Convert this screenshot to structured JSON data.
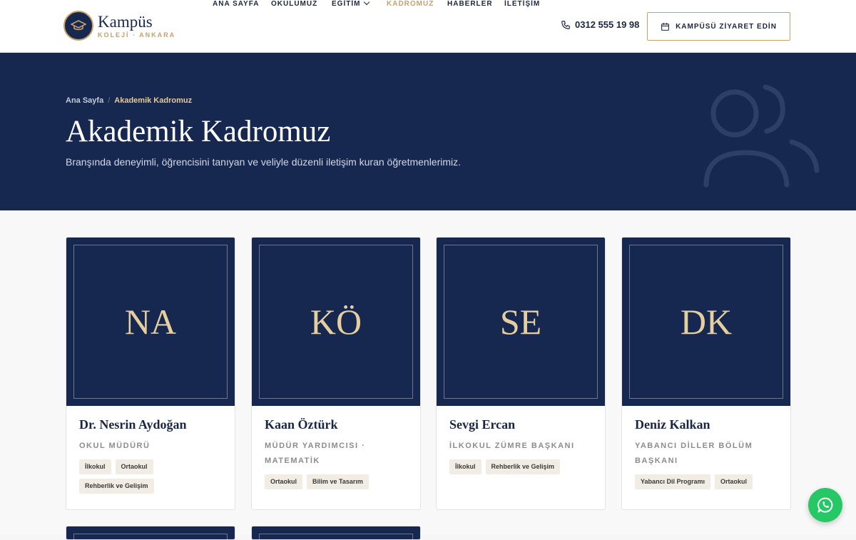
{
  "brand": {
    "name": "Kampüs",
    "subtitle": "KOLEJİ · ANKARA"
  },
  "nav": {
    "items": [
      {
        "label": "ANA SAYFA"
      },
      {
        "label": "OKULUMUZ"
      },
      {
        "label": "EĞİTİM"
      },
      {
        "label": "KADROMUZ"
      },
      {
        "label": "HABERLER"
      },
      {
        "label": "İLETİŞİM"
      }
    ],
    "active": "KADROMUZ",
    "phone": "0312 555 19 98",
    "cta_label": "KAMPÜSÜ ZİYARET EDİN"
  },
  "hero": {
    "breadcrumb_home": "Ana Sayfa",
    "breadcrumb_separator": "/",
    "breadcrumb_current": "Akademik Kadromuz",
    "title": "Akademik Kadromuz",
    "subtitle": "Branşında deneyimli, öğrencisini tanıyan ve veliyle düzenli iletişim kuran öğretmenlerimiz."
  },
  "staff": [
    {
      "initials": "NA",
      "name": "Dr. Nesrin Aydoğan",
      "role": "OKUL MÜDÜRÜ",
      "tags": [
        "İlkokul",
        "Ortaokul",
        "Rehberlik ve Gelişim"
      ]
    },
    {
      "initials": "KÖ",
      "name": "Kaan Öztürk",
      "role": "MÜDÜR YARDIMCISI · MATEMATİK",
      "tags": [
        "Ortaokul",
        "Bilim ve Tasarım"
      ]
    },
    {
      "initials": "SE",
      "name": "Sevgi Ercan",
      "role": "İLKOKUL ZÜMRE BAŞKANI",
      "tags": [
        "İlkokul",
        "Rehberlik ve Gelişim"
      ]
    },
    {
      "initials": "DK",
      "name": "Deniz Kalkan",
      "role": "YABANCI DİLLER BÖLÜM BAŞKANI",
      "tags": [
        "Yabancı Dil Programı",
        "Ortaokul"
      ]
    }
  ],
  "colors": {
    "navy": "#172850",
    "gold": "#c8a06a",
    "whatsapp": "#25c864"
  },
  "icons": {
    "phone": "phone-icon",
    "calendar": "calendar-icon",
    "whatsapp": "whatsapp-icon",
    "users": "users-icon",
    "graduation": "graduation-cap-icon"
  }
}
